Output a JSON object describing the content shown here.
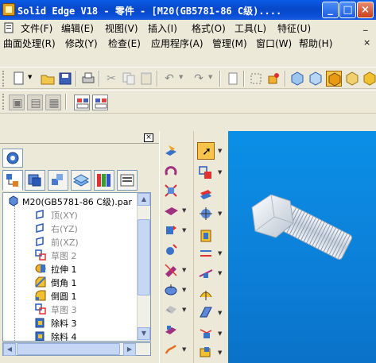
{
  "window": {
    "title": "Solid Edge V18 - 零件 - [M20(GB5781-86 C级)...."
  },
  "menubar1": {
    "items": [
      "文件(F)",
      "编辑(E)",
      "视图(V)",
      "插入(I)",
      "格式(O)",
      "工具(L)",
      "特征(U)"
    ]
  },
  "menubar2": {
    "items": [
      "曲面处理(R)",
      "修改(Y)",
      "检查(E)",
      "应用程序(A)",
      "管理(M)",
      "窗口(W)",
      "帮助(H)"
    ]
  },
  "pathfinder": {
    "tree": [
      {
        "label": "M20(GB5781-86 C级).par",
        "icon": "part-file-icon",
        "dim": false
      },
      {
        "label": "顶(XY)",
        "icon": "reference-plane-icon",
        "dim": true
      },
      {
        "label": "右(YZ)",
        "icon": "reference-plane-icon",
        "dim": true
      },
      {
        "label": "前(XZ)",
        "icon": "reference-plane-icon",
        "dim": true
      },
      {
        "label": "草图 2",
        "icon": "sketch-icon",
        "dim": true
      },
      {
        "label": "拉伸 1",
        "icon": "extrude-icon",
        "dim": false
      },
      {
        "label": "倒角 1",
        "icon": "chamfer-icon",
        "dim": false
      },
      {
        "label": "倒圆 1",
        "icon": "round-icon",
        "dim": false
      },
      {
        "label": "草图 3",
        "icon": "sketch-icon",
        "dim": true
      },
      {
        "label": "除料 3",
        "icon": "cutout-icon",
        "dim": false
      },
      {
        "label": "除料 4",
        "icon": "cutout-icon",
        "dim": false
      }
    ]
  },
  "colors": {
    "titlebar": "#0a5ce6",
    "viewport": "#0c7fd8",
    "part": "#dfe6ee"
  }
}
